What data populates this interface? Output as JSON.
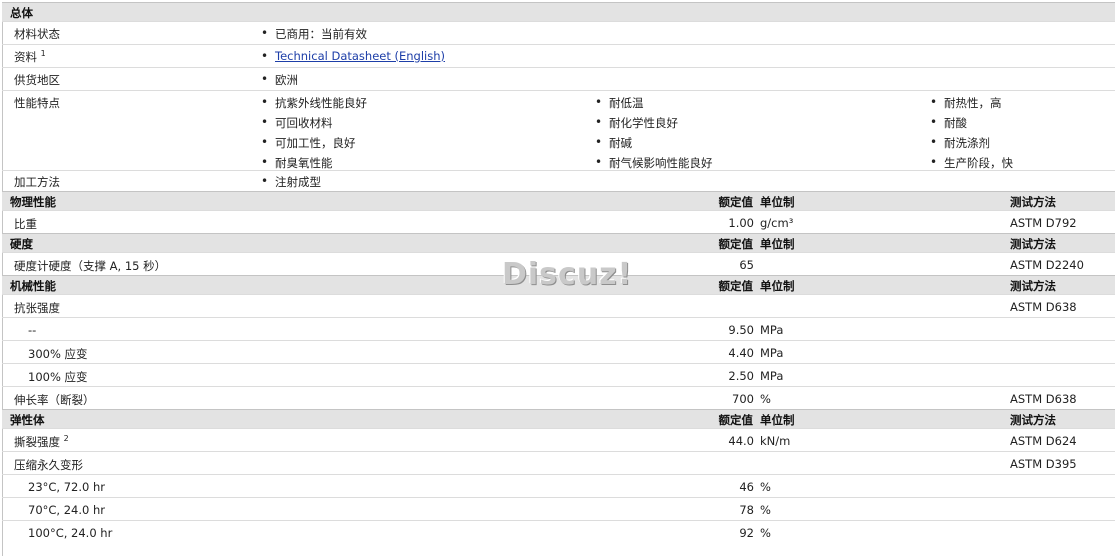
{
  "general": {
    "title": "总体",
    "status_label": "材料状态",
    "status_value": "已商用：当前有效",
    "doc_label": "资料",
    "doc_sup": "1",
    "doc_link": "Technical Datasheet (English)",
    "region_label": "供货地区",
    "region_value": "欧洲",
    "features_label": "性能特点",
    "features_col1": [
      "抗紫外线性能良好",
      "可回收材料",
      "可加工性，良好",
      "耐臭氧性能"
    ],
    "features_col2": [
      "耐低温",
      "耐化学性良好",
      "耐碱",
      "耐气候影响性能良好"
    ],
    "features_col3": [
      "耐热性，高",
      "耐酸",
      "耐洗涤剂",
      "生产阶段，快"
    ],
    "process_label": "加工方法",
    "process_value": "注射成型"
  },
  "headers": {
    "nominal": "额定值",
    "unit": "单位制",
    "test": "测试方法"
  },
  "physical": {
    "title": "物理性能",
    "rows": [
      {
        "label": "比重",
        "value": "1.00",
        "unit": "g/cm³",
        "test": "ASTM D792"
      }
    ]
  },
  "hardness": {
    "title": "硬度",
    "rows": [
      {
        "label": "硬度计硬度（支撑 A, 15 秒）",
        "value": "65",
        "unit": "",
        "test": "ASTM D2240"
      }
    ]
  },
  "mechanical": {
    "title": "机械性能",
    "rows": [
      {
        "label": "抗张强度",
        "value": "",
        "unit": "",
        "test": "ASTM D638"
      },
      {
        "label": "--",
        "value": "9.50",
        "unit": "MPa",
        "test": ""
      },
      {
        "label": "300% 应变",
        "value": "4.40",
        "unit": "MPa",
        "test": ""
      },
      {
        "label": "100% 应变",
        "value": "2.50",
        "unit": "MPa",
        "test": ""
      },
      {
        "label": "伸长率（断裂）",
        "value": "700",
        "unit": "%",
        "test": "ASTM D638"
      }
    ]
  },
  "elastomer": {
    "title": "弹性体",
    "tear_label": "撕裂强度",
    "tear_sup": "2",
    "rows": [
      {
        "label": "撕裂强度",
        "value": "44.0",
        "unit": "kN/m",
        "test": "ASTM D624"
      },
      {
        "label": "压缩永久变形",
        "value": "",
        "unit": "",
        "test": "ASTM D395"
      },
      {
        "label": "23°C, 72.0 hr",
        "value": "46",
        "unit": "%",
        "test": ""
      },
      {
        "label": "70°C, 24.0 hr",
        "value": "78",
        "unit": "%",
        "test": ""
      },
      {
        "label": "100°C, 24.0 hr",
        "value": "92",
        "unit": "%",
        "test": ""
      }
    ]
  },
  "watermark": "Discuz!"
}
